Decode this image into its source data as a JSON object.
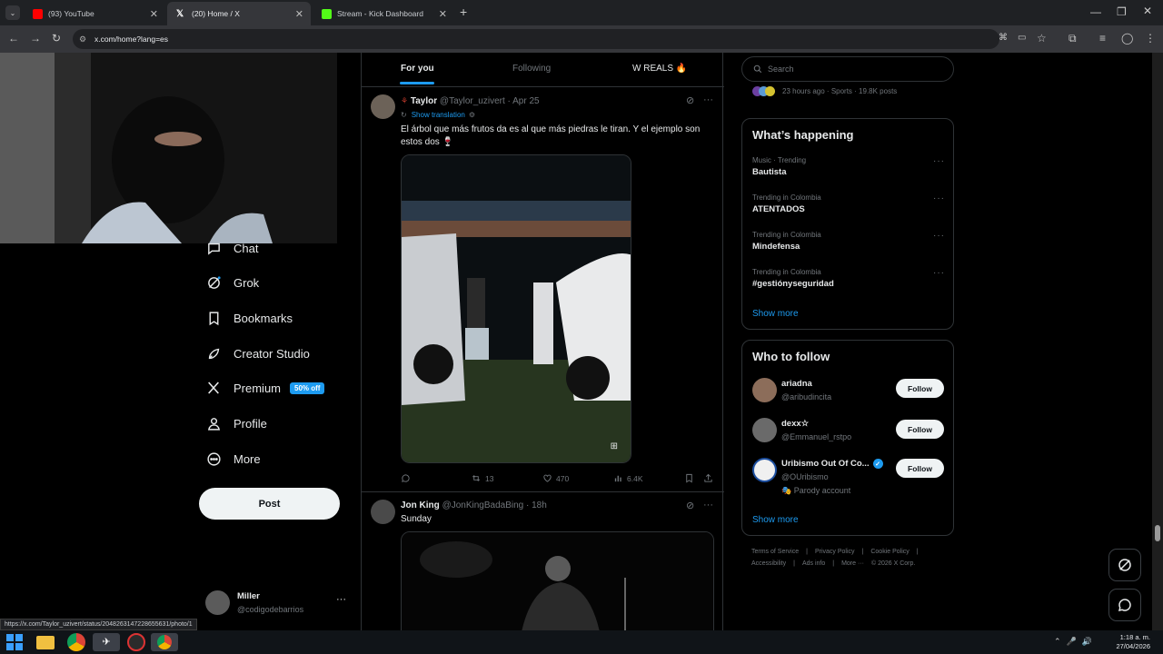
{
  "browser": {
    "tabs": [
      {
        "label": "(93) YouTube",
        "icon_color": "#ff0000"
      },
      {
        "label": "(20) Home / X",
        "icon_color": "#ffffff"
      },
      {
        "label": "Stream - Kick Dashboard",
        "icon_color": "#53fc18"
      }
    ],
    "url": "x.com/home?lang=es",
    "status_url": "https://x.com/Taylor_uzivert/status/2048263147228655631/photo/1"
  },
  "sidebar": {
    "items": [
      {
        "label": "Chat",
        "icon": "chat-icon"
      },
      {
        "label": "Grok",
        "icon": "grok-icon"
      },
      {
        "label": "Bookmarks",
        "icon": "bookmark-icon"
      },
      {
        "label": "Creator Studio",
        "icon": "rocket-icon"
      },
      {
        "label": "Premium",
        "icon": "x-logo-icon"
      },
      {
        "label": "Profile",
        "icon": "person-icon"
      },
      {
        "label": "More",
        "icon": "more-circle-icon"
      }
    ],
    "premium_badge": "50% off",
    "post_label": "Post",
    "account": {
      "name": "Miller",
      "handle": "@codigodebarrios"
    }
  },
  "feed": {
    "tabs": [
      "For you",
      "Following",
      "W REALS 🔥"
    ],
    "tweets": [
      {
        "name": "Taylor",
        "handle": "@Taylor_uzivert",
        "time": "· Apr 25",
        "translation": "Show translation",
        "text": "El árbol que más frutos da es al que más piedras le tiran. Y el ejemplo son estos dos 🍷",
        "retweets": "13",
        "likes": "470",
        "views": "6.4K"
      },
      {
        "name": "Jon King",
        "handle": "@JonKingBadaBing",
        "time": "· 18h",
        "text": "Sunday"
      }
    ]
  },
  "right": {
    "search_placeholder": "Search",
    "top_meta": "23 hours ago · Sports · 19.8K posts",
    "happening_title": "What’s happening",
    "trends": [
      {
        "meta": "Music · Trending",
        "name": "Bautista"
      },
      {
        "meta": "Trending in Colombia",
        "name": "ATENTADOS"
      },
      {
        "meta": "Trending in Colombia",
        "name": "Mindefensa"
      },
      {
        "meta": "Trending in Colombia",
        "name": "#gestiónyseguridad"
      }
    ],
    "show_more": "Show more",
    "who_title": "Who to follow",
    "follow": [
      {
        "name": "ariadna",
        "handle": "@aribudincita",
        "extra": ""
      },
      {
        "name": "dexx☆",
        "handle": "@Emmanuel_rstpo",
        "extra": ""
      },
      {
        "name": "Uribismo Out Of Co...",
        "handle": "@OUribismo",
        "extra": "🎭 Parody account"
      }
    ],
    "follow_label": "Follow",
    "footer": [
      "Terms of Service",
      "|",
      "Privacy Policy",
      "|",
      "Cookie Policy",
      "|",
      "Accessibility",
      "|",
      "Ads info",
      "|",
      "More ···",
      "© 2026 X Corp."
    ]
  },
  "taskbar": {
    "time": "1:18 a. m.",
    "date": "27/04/2026"
  }
}
